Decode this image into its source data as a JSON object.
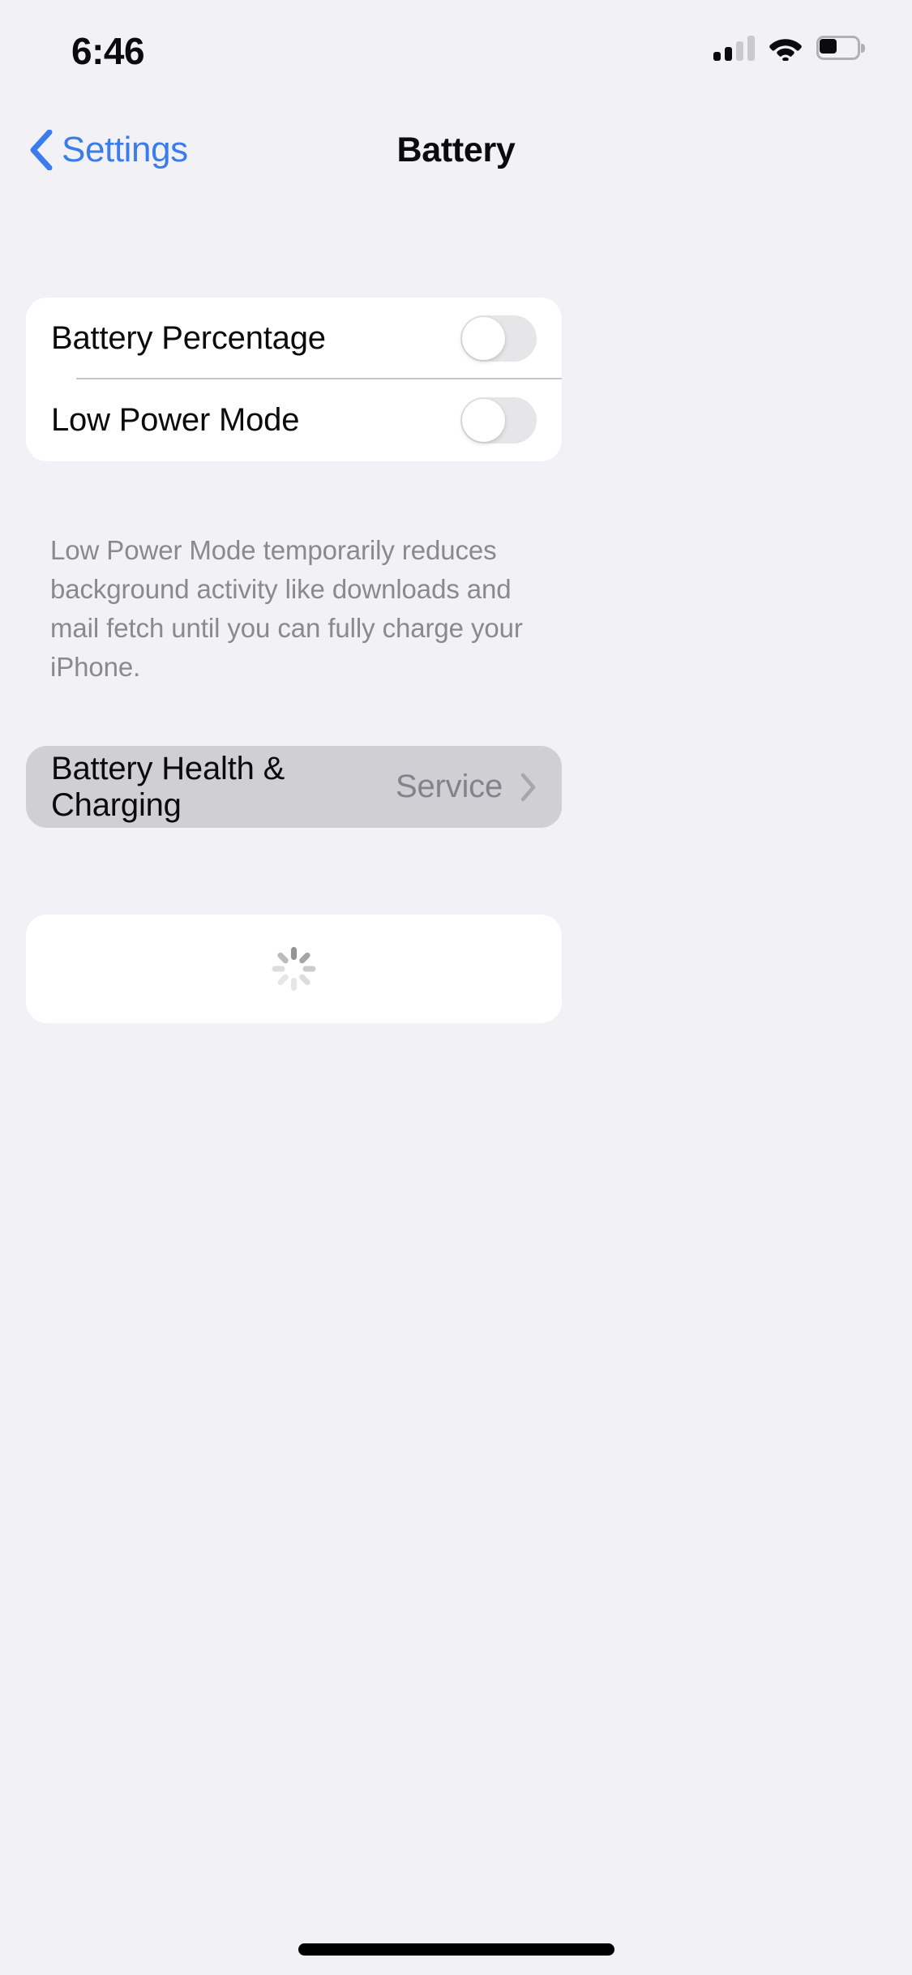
{
  "status_bar": {
    "time": "6:46",
    "cellular_icon": "cellular-signal-icon",
    "cellular_bars_filled": 2,
    "cellular_bars_total": 4,
    "wifi_icon": "wifi-icon",
    "battery_icon": "battery-icon",
    "battery_level_percent": 45
  },
  "nav": {
    "back_icon": "chevron-left-icon",
    "back_label": "Settings",
    "title": "Battery"
  },
  "toggles_section": {
    "rows": [
      {
        "label": "Battery Percentage",
        "control": "toggle",
        "state": "off"
      },
      {
        "label": "Low Power Mode",
        "control": "toggle",
        "state": "off"
      }
    ],
    "footer": "Low Power Mode temporarily reduces background activity like downloads and mail fetch until you can fully charge your iPhone."
  },
  "health_section": {
    "label": "Battery Health & Charging",
    "value": "Service",
    "disclosure_icon": "chevron-right-icon",
    "highlighted": true
  },
  "usage_section": {
    "state": "loading",
    "spinner_icon": "activity-indicator-icon"
  },
  "home_indicator": "home-indicator",
  "colors": {
    "background": "#f2f1f6",
    "card": "#ffffff",
    "card_pressed": "#d0d0d4",
    "accent_blue": "#3b7ced",
    "primary_text": "#0b0b0d",
    "secondary_text": "#8a8a8e",
    "separator": "#c6c6c8",
    "switch_off_track": "#e6e6e8"
  }
}
